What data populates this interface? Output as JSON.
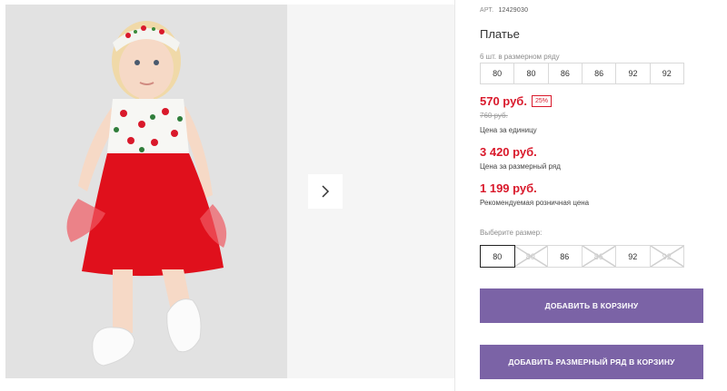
{
  "product": {
    "sku_label": "АРТ.",
    "sku_value": "12429030",
    "title": "Платье"
  },
  "pack": {
    "note": "6 шт. в размерном ряду",
    "sizes": [
      "80",
      "80",
      "86",
      "86",
      "92",
      "92"
    ]
  },
  "prices": {
    "unit_price": "570 руб.",
    "discount": "25%",
    "old_price": "760 руб.",
    "unit_note": "Цена за единицу",
    "set_price": "3 420 руб.",
    "set_note": "Цена за размерный ряд",
    "rrp_price": "1 199 руб.",
    "rrp_note": "Рекомендуемая розничная цена"
  },
  "size_select": {
    "label": "Выберите размер:",
    "options": [
      {
        "label": "80",
        "state": "selected"
      },
      {
        "label": "80",
        "state": "disabled"
      },
      {
        "label": "86",
        "state": "available"
      },
      {
        "label": "86",
        "state": "disabled"
      },
      {
        "label": "92",
        "state": "available"
      },
      {
        "label": "92",
        "state": "disabled"
      }
    ]
  },
  "actions": {
    "add_to_cart": "ДОБАВИТЬ В КОРЗИНУ",
    "add_set_to_cart": "ДОБАВИТЬ РАЗМЕРНЫЙ РЯД В КОРЗИНУ"
  },
  "gallery": {
    "next_icon": "chevron-right-icon"
  },
  "colors": {
    "accent": "#7b63a6",
    "price_red": "#d9192b",
    "dress_red": "#e0101c"
  }
}
